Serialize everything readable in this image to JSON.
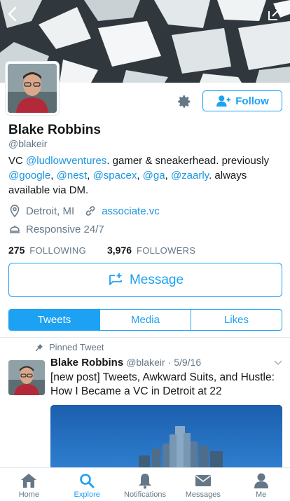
{
  "header": {
    "back_icon": "chevron-left-icon",
    "share_icon": "share-icon",
    "banner_colors": [
      "#2b3137",
      "#cfd6d9",
      "#f2f4f5"
    ]
  },
  "profile": {
    "name": "Blake Robbins",
    "handle": "@blakeir",
    "bio": {
      "prefix": "VC ",
      "link1": "@ludlowventures",
      "mid1": ". gamer & sneakerhead. previously ",
      "link2": "@google",
      "sep1": ", ",
      "link3": "@nest",
      "sep2": ", ",
      "link4": "@spacex",
      "sep3": ", ",
      "link5": "@ga",
      "sep4": ", ",
      "link6": "@zaarly",
      "suffix": ". always available via DM."
    },
    "location": "Detroit, MI",
    "website": "associate.vc",
    "responsive": "Responsive 24/7",
    "following_count": "275",
    "following_label": "FOLLOWING",
    "followers_count": "3,976",
    "followers_label": "FOLLOWERS"
  },
  "actions": {
    "follow_label": "Follow",
    "message_label": "Message"
  },
  "tabs": [
    {
      "label": "Tweets",
      "active": true
    },
    {
      "label": "Media",
      "active": false
    },
    {
      "label": "Likes",
      "active": false
    }
  ],
  "pinned_tweet": {
    "pinned_label": "Pinned Tweet",
    "author_name": "Blake Robbins",
    "author_handle": "@blakeir",
    "date": "· 5/9/16",
    "text": "[new post] Tweets, Awkward Suits, and Hustle: How I Became a VC in Detroit at 22"
  },
  "bottom_nav": [
    {
      "label": "Home",
      "icon": "home-icon",
      "active": false
    },
    {
      "label": "Explore",
      "icon": "search-icon",
      "active": true
    },
    {
      "label": "Notifications",
      "icon": "bell-icon",
      "active": false
    },
    {
      "label": "Messages",
      "icon": "envelope-icon",
      "active": false
    },
    {
      "label": "Me",
      "icon": "person-icon",
      "active": false
    }
  ],
  "colors": {
    "accent": "#1da1f2",
    "link": "#1b95e0",
    "muted": "#657786",
    "text": "#14171a"
  }
}
